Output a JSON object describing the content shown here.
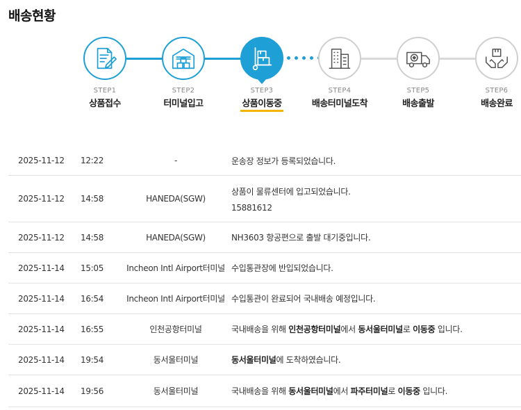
{
  "page_title": "배송현황",
  "accent_color": "#1e9fd6",
  "underline_color": "#f5b400",
  "steps": [
    {
      "num": "STEP1",
      "name": "상품접수",
      "icon": "document-edit-icon",
      "state": "done"
    },
    {
      "num": "STEP2",
      "name": "터미널입고",
      "icon": "warehouse-icon",
      "state": "done"
    },
    {
      "num": "STEP3",
      "name": "상품이동중",
      "icon": "hand-truck-icon",
      "state": "current"
    },
    {
      "num": "STEP4",
      "name": "배송터미널도착",
      "icon": "building-icon",
      "state": "pending"
    },
    {
      "num": "STEP5",
      "name": "배송출발",
      "icon": "delivery-truck-icon",
      "state": "pending"
    },
    {
      "num": "STEP6",
      "name": "배송완료",
      "icon": "hands-package-icon",
      "state": "pending"
    }
  ],
  "events": [
    {
      "date": "2025-11-12",
      "time": "12:22",
      "location": "-",
      "message": [
        [
          "운송장 정보가 등록되었습니다.",
          false
        ]
      ],
      "extra": ""
    },
    {
      "date": "2025-11-12",
      "time": "14:58",
      "location": "HANEDA(SGW)",
      "message": [
        [
          "상품이 물류센터에 입고되었습니다.",
          false
        ]
      ],
      "extra": "15881612"
    },
    {
      "date": "2025-11-12",
      "time": "14:58",
      "location": "HANEDA(SGW)",
      "message": [
        [
          "NH3603 항공편으로 출발 대기중입니다.",
          false
        ]
      ],
      "extra": ""
    },
    {
      "date": "2025-11-14",
      "time": "15:05",
      "location": "Incheon Intl Airport터미널",
      "message": [
        [
          "수입통관장에 반입되었습니다.",
          false
        ]
      ],
      "extra": ""
    },
    {
      "date": "2025-11-14",
      "time": "16:54",
      "location": "Incheon Intl Airport터미널",
      "message": [
        [
          "수입통관이 완료되어 국내배송 예정입니다.",
          false
        ]
      ],
      "extra": ""
    },
    {
      "date": "2025-11-14",
      "time": "16:55",
      "location": "인천공항터미널",
      "message": [
        [
          "국내배송을 위해 ",
          false
        ],
        [
          "인천공항터미널",
          true
        ],
        [
          "에서 ",
          false
        ],
        [
          "동서울터미널",
          true
        ],
        [
          "로 ",
          false
        ],
        [
          "이동중",
          true
        ],
        [
          " 입니다.",
          false
        ]
      ],
      "extra": ""
    },
    {
      "date": "2025-11-14",
      "time": "19:54",
      "location": "동서울터미널",
      "message": [
        [
          "동서울터미널",
          true
        ],
        [
          "에 도착하였습니다.",
          false
        ]
      ],
      "extra": ""
    },
    {
      "date": "2025-11-14",
      "time": "19:56",
      "location": "동서울터미널",
      "message": [
        [
          "국내배송을 위해 ",
          false
        ],
        [
          "동서울터미널",
          true
        ],
        [
          "에서 ",
          false
        ],
        [
          "파주터미널",
          true
        ],
        [
          "로 ",
          false
        ],
        [
          "이동중",
          true
        ],
        [
          " 입니다.",
          false
        ]
      ],
      "extra": ""
    }
  ]
}
